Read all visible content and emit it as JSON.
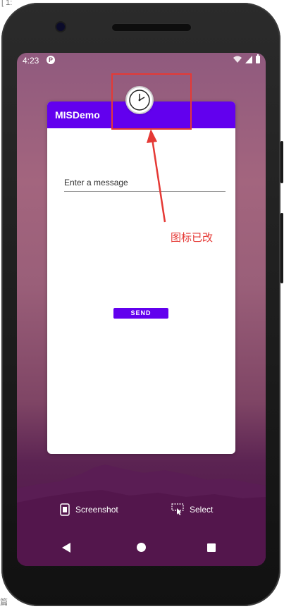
{
  "status_bar": {
    "time": "4:23"
  },
  "app": {
    "title": "MISDemo",
    "input_placeholder": "Enter a message",
    "send_label": "SEND"
  },
  "annotation": {
    "text": "图标已改",
    "color": "#e53935"
  },
  "bottom_actions": {
    "screenshot_label": "Screenshot",
    "select_label": "Select"
  },
  "edge_text": {
    "top": "[ 1:",
    "bottom": "篇"
  },
  "colors": {
    "accent": "#6200ee",
    "annotation_red": "#e53935"
  }
}
